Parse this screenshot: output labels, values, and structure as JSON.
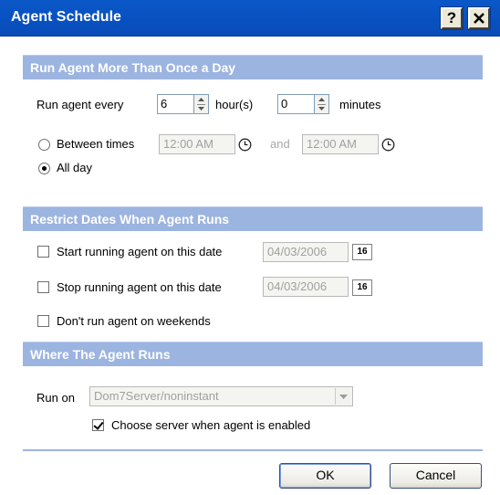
{
  "window": {
    "title": "Agent Schedule",
    "help_label": "?"
  },
  "section_run_more": {
    "header": "Run Agent More Than Once a Day",
    "run_every_label": "Run agent every",
    "hours_value": "6",
    "hours_unit": "hour(s)",
    "minutes_value": "0",
    "minutes_unit": "minutes",
    "between_times_label": "Between times",
    "between_times_selected": false,
    "start_time": "12:00 AM",
    "and_label": "and",
    "end_time": "12:00 AM",
    "all_day_label": "All day",
    "all_day_selected": true
  },
  "section_restrict": {
    "header": "Restrict Dates When Agent Runs",
    "start_label": "Start running agent on this date",
    "start_checked": false,
    "start_date": "04/03/2006",
    "stop_label": "Stop running agent on this date",
    "stop_checked": false,
    "stop_date": "04/03/2006",
    "calendar_label": "16",
    "weekends_label": "Don't run agent on weekends",
    "weekends_checked": false
  },
  "section_where": {
    "header": "Where The Agent Runs",
    "run_on_label": "Run on",
    "server_value": "Dom7Server/noninstant",
    "choose_server_label": "Choose server when agent is enabled",
    "choose_server_checked": true
  },
  "buttons": {
    "ok": "OK",
    "cancel": "Cancel"
  },
  "colors": {
    "titlebar": "#0a58c8",
    "section_header": "#9cb4e0"
  }
}
